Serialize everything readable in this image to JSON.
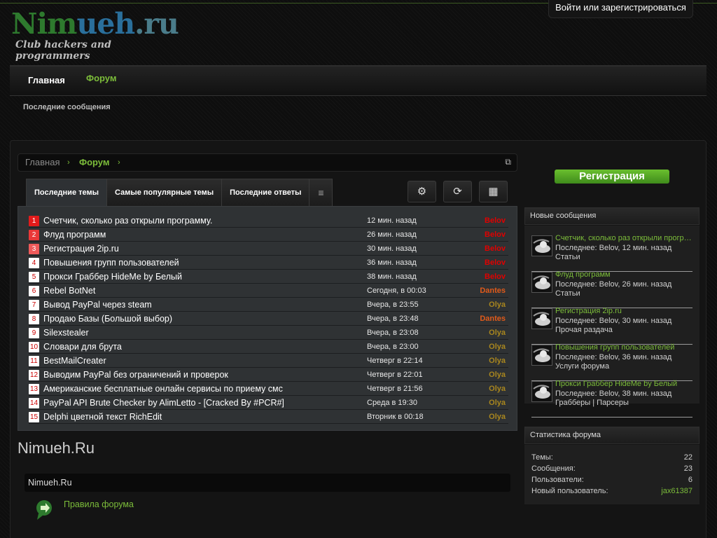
{
  "header": {
    "logo_part1": "Nim",
    "logo_part2": "ueh",
    "logo_part3": ".ru",
    "logo_subtitle": "Club  hackers and programmers",
    "login_link": "Войти или зарегистрироваться"
  },
  "nav": {
    "home": "Главная",
    "forum": "Форум",
    "sub_recent": "Последние сообщения"
  },
  "breadcrumb": {
    "home": "Главная",
    "forum": "Форум",
    "separator": "›",
    "external_icon": "⧉"
  },
  "tabs": [
    {
      "label": "Последние темы",
      "active": true
    },
    {
      "label": "Самые популярные темы",
      "active": false
    },
    {
      "label": "Последние ответы",
      "active": false
    }
  ],
  "tab_menu_icon": "≡",
  "toolbar": {
    "settings_icon": "⚙",
    "refresh_icon": "⟳",
    "layout_icon": "▦"
  },
  "colors": {
    "accent": "#7cbd3a",
    "user_belov": "#e00000",
    "user_dantes": "#e05a1a",
    "user_olya": "#a8861e"
  },
  "threads": [
    {
      "n": "1",
      "title": "Счетчик, сколько раз открыли программу.",
      "time": "12 мин. назад",
      "user": "Belov",
      "color": "#e00000",
      "badge": "hot1"
    },
    {
      "n": "2",
      "title": "Флуд программ",
      "time": "26 мин. назад",
      "user": "Belov",
      "color": "#e00000",
      "badge": "hot2"
    },
    {
      "n": "3",
      "title": "Регистрация 2ip.ru",
      "time": "30 мин. назад",
      "user": "Belov",
      "color": "#e00000",
      "badge": "hot3"
    },
    {
      "n": "4",
      "title": "Повышения групп пользователей",
      "time": "36 мин. назад",
      "user": "Belov",
      "color": "#e00000",
      "badge": ""
    },
    {
      "n": "5",
      "title": "Прокси Граббер HideMe by Белый",
      "time": "38 мин. назад",
      "user": "Belov",
      "color": "#e00000",
      "badge": ""
    },
    {
      "n": "6",
      "title": "Rebel BotNet",
      "time": "Сегодня, в 00:03",
      "user": "Dantes",
      "color": "#e05a1a",
      "badge": ""
    },
    {
      "n": "7",
      "title": "Вывод PayPal через steam",
      "time": "Вчера, в 23:55",
      "user": "Olya",
      "color": "#a8861e",
      "badge": ""
    },
    {
      "n": "8",
      "title": "Продаю Базы (Большой выбор)",
      "time": "Вчера, в 23:48",
      "user": "Dantes",
      "color": "#e05a1a",
      "badge": ""
    },
    {
      "n": "9",
      "title": "Silexstealer",
      "time": "Вчера, в 23:08",
      "user": "Olya",
      "color": "#a8861e",
      "badge": ""
    },
    {
      "n": "10",
      "title": "Словари для брута",
      "time": "Вчера, в 23:00",
      "user": "Olya",
      "color": "#a8861e",
      "badge": ""
    },
    {
      "n": "11",
      "title": "BestMailCreater",
      "time": "Четверг в 22:14",
      "user": "Olya",
      "color": "#a8861e",
      "badge": ""
    },
    {
      "n": "12",
      "title": "Выводим PayPal без ограничений и проверок",
      "time": "Четверг в 22:01",
      "user": "Olya",
      "color": "#a8861e",
      "badge": ""
    },
    {
      "n": "13",
      "title": "Американские бесплатные онлайн сервисы по приему смс",
      "time": "Четверг в 21:56",
      "user": "Olya",
      "color": "#a8861e",
      "badge": ""
    },
    {
      "n": "14",
      "title": "PayPal API Brute Checker by AlimLetto - [Cracked By #PCR#]",
      "time": "Среда в 19:30",
      "user": "Olya",
      "color": "#a8861e",
      "badge": ""
    },
    {
      "n": "15",
      "title": "Delphi цветной текст RichEdit",
      "time": "Вторник в 00:18",
      "user": "Olya",
      "color": "#a8861e",
      "badge": ""
    }
  ],
  "main": {
    "site_heading": "Nimueh.Ru",
    "category": "Nimueh.Ru",
    "rules_link": "Правила форума"
  },
  "sidebar": {
    "register_button": "Регистрация",
    "new_posts_title": "Новые сообщения",
    "new_posts": [
      {
        "title": "Счетчик, сколько раз открыли програ...",
        "meta": "Последнее: Belov, 12 мин. назад",
        "forum": "Статьи"
      },
      {
        "title": "Флуд программ",
        "meta": "Последнее: Belov, 26 мин. назад",
        "forum": "Статьи"
      },
      {
        "title": "Регистрация 2ip.ru",
        "meta": "Последнее: Belov, 30 мин. назад",
        "forum": "Прочая раздача"
      },
      {
        "title": "Повышения групп пользователей",
        "meta": "Последнее: Belov, 36 мин. назад",
        "forum": "Услуги форума"
      },
      {
        "title": "Прокси Граббер HideMe by Белый",
        "meta": "Последнее: Belov, 38 мин. назад",
        "forum": "Грабберы | Парсеры"
      }
    ],
    "stats_title": "Статистика форума",
    "stats": [
      {
        "label": "Темы:",
        "value": "22"
      },
      {
        "label": "Сообщения:",
        "value": "23"
      },
      {
        "label": "Пользователи:",
        "value": "6"
      },
      {
        "label": "Новый пользователь:",
        "value": "jax61387"
      }
    ]
  }
}
